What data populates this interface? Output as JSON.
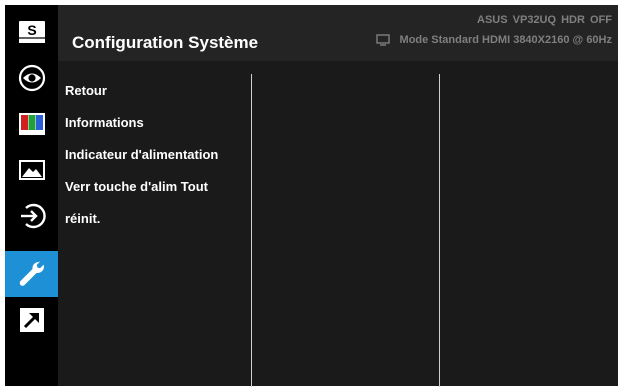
{
  "sidebar": {
    "items": [
      {
        "icon": "splendid-s-icon",
        "label": "S"
      },
      {
        "icon": "eye-icon"
      },
      {
        "icon": "color-bars-icon",
        "colors": [
          "#d02020",
          "#22a03a",
          "#2a5fd6"
        ]
      },
      {
        "icon": "image-icon"
      },
      {
        "icon": "input-select-icon"
      },
      {
        "icon": "wrench-icon",
        "active": true
      },
      {
        "icon": "shortcut-arrow-icon"
      }
    ],
    "active_color": "#1e90d6"
  },
  "header": {
    "title": "Configuration Système",
    "status_line1": "ASUS  VP32UQ  HDR OFF",
    "status_line2": "Mode Standard HDMI 3840X2160 @ 60Hz"
  },
  "menu": {
    "items": [
      "Retour",
      "Informations",
      "Indicateur d'alimentation",
      "Verr touche d'alim Tout",
      "réinit."
    ]
  }
}
